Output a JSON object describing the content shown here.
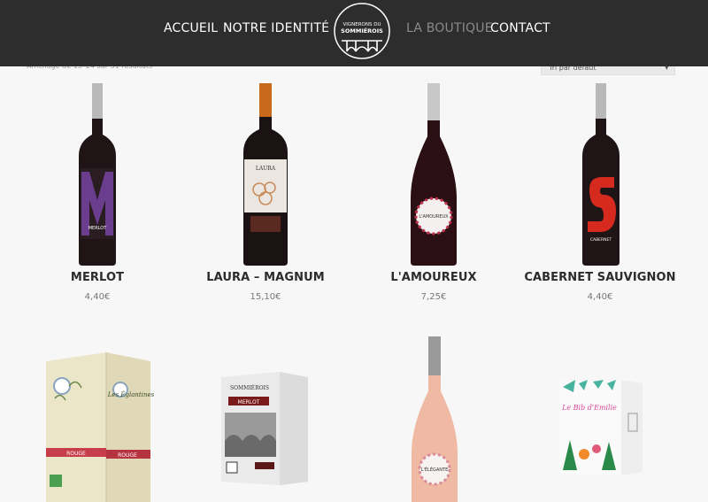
{
  "nav": {
    "accueil": "ACCUEIL",
    "identite": "NOTRE IDENTITÉ",
    "boutique": "LA BOUTIQUE",
    "contact": "CONTACT"
  },
  "logo": {
    "line1": "VIGNERONS DU",
    "line2": "SOMMIÉROIS"
  },
  "shop": {
    "result_count": "Affichage de 13–24 sur 31 résultats",
    "sort_value": "Tri par défaut"
  },
  "products": [
    {
      "name": "MERLOT",
      "price": "4,40€",
      "label_text": "MERLOT",
      "accent": "#6b3d8f"
    },
    {
      "name": "LAURA – MAGNUM",
      "price": "15,10€",
      "label_text": "LAURA",
      "accent": "#c98a5a"
    },
    {
      "name": "L'AMOUREUX",
      "price": "7,25€",
      "label_text": "L'AMOUREUX",
      "accent": "#c0304a"
    },
    {
      "name": "CABERNET SAUVIGNON",
      "price": "4,40€",
      "label_text": "CABERNET",
      "accent": "#d62a1f"
    }
  ],
  "products_row2": [
    {
      "label_text": "Les Églantines",
      "label_sub": "ROUGE"
    },
    {
      "label_text": "SOMMIÉROIS",
      "label_sub": "MERLOT"
    },
    {
      "label_text": "L'ÉLÉGANTE"
    },
    {
      "label_text": "Le Bib d'Emilie"
    }
  ],
  "colors": {
    "header_bg": "#2d2d2d",
    "page_bg": "#f7f7f7",
    "nav_active": "#8a8a8a"
  }
}
